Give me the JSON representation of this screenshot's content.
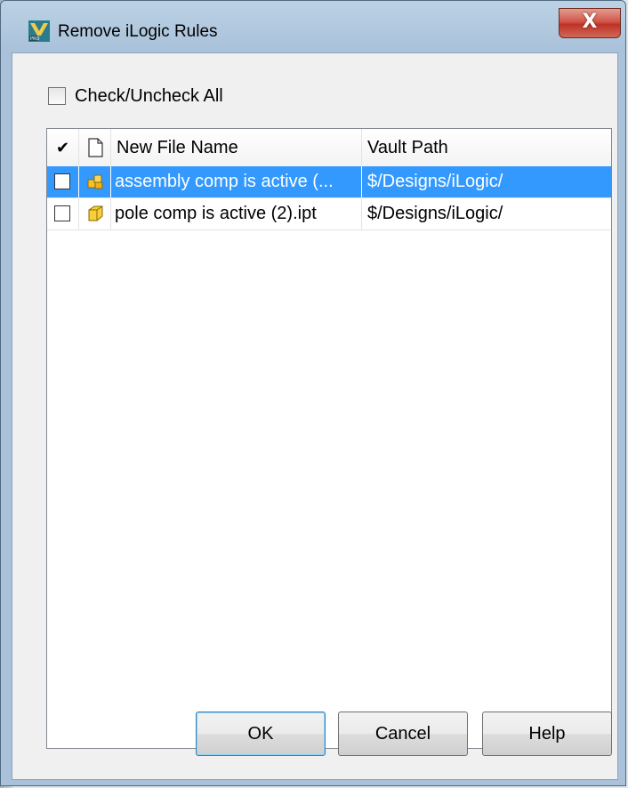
{
  "window": {
    "title": "Remove iLogic Rules",
    "close_glyph": "X",
    "app_icon": "autodesk-inventor-pro-icon"
  },
  "check_all": {
    "label": "Check/Uncheck All",
    "checked": false
  },
  "list": {
    "columns": {
      "check": "✔",
      "icon": "file-icon",
      "name": "New File Name",
      "path": "Vault Path"
    },
    "rows": [
      {
        "checked": false,
        "icon": "assembly-icon",
        "name": "assembly comp is active (...",
        "path": "$/Designs/iLogic/",
        "selected": true
      },
      {
        "checked": false,
        "icon": "part-icon",
        "name": "pole comp is active (2).ipt",
        "path": "$/Designs/iLogic/",
        "selected": false
      }
    ]
  },
  "buttons": {
    "ok": "OK",
    "cancel": "Cancel",
    "help": "Help"
  },
  "colors": {
    "selection": "#3399ff",
    "close_button": "#c7463a"
  }
}
